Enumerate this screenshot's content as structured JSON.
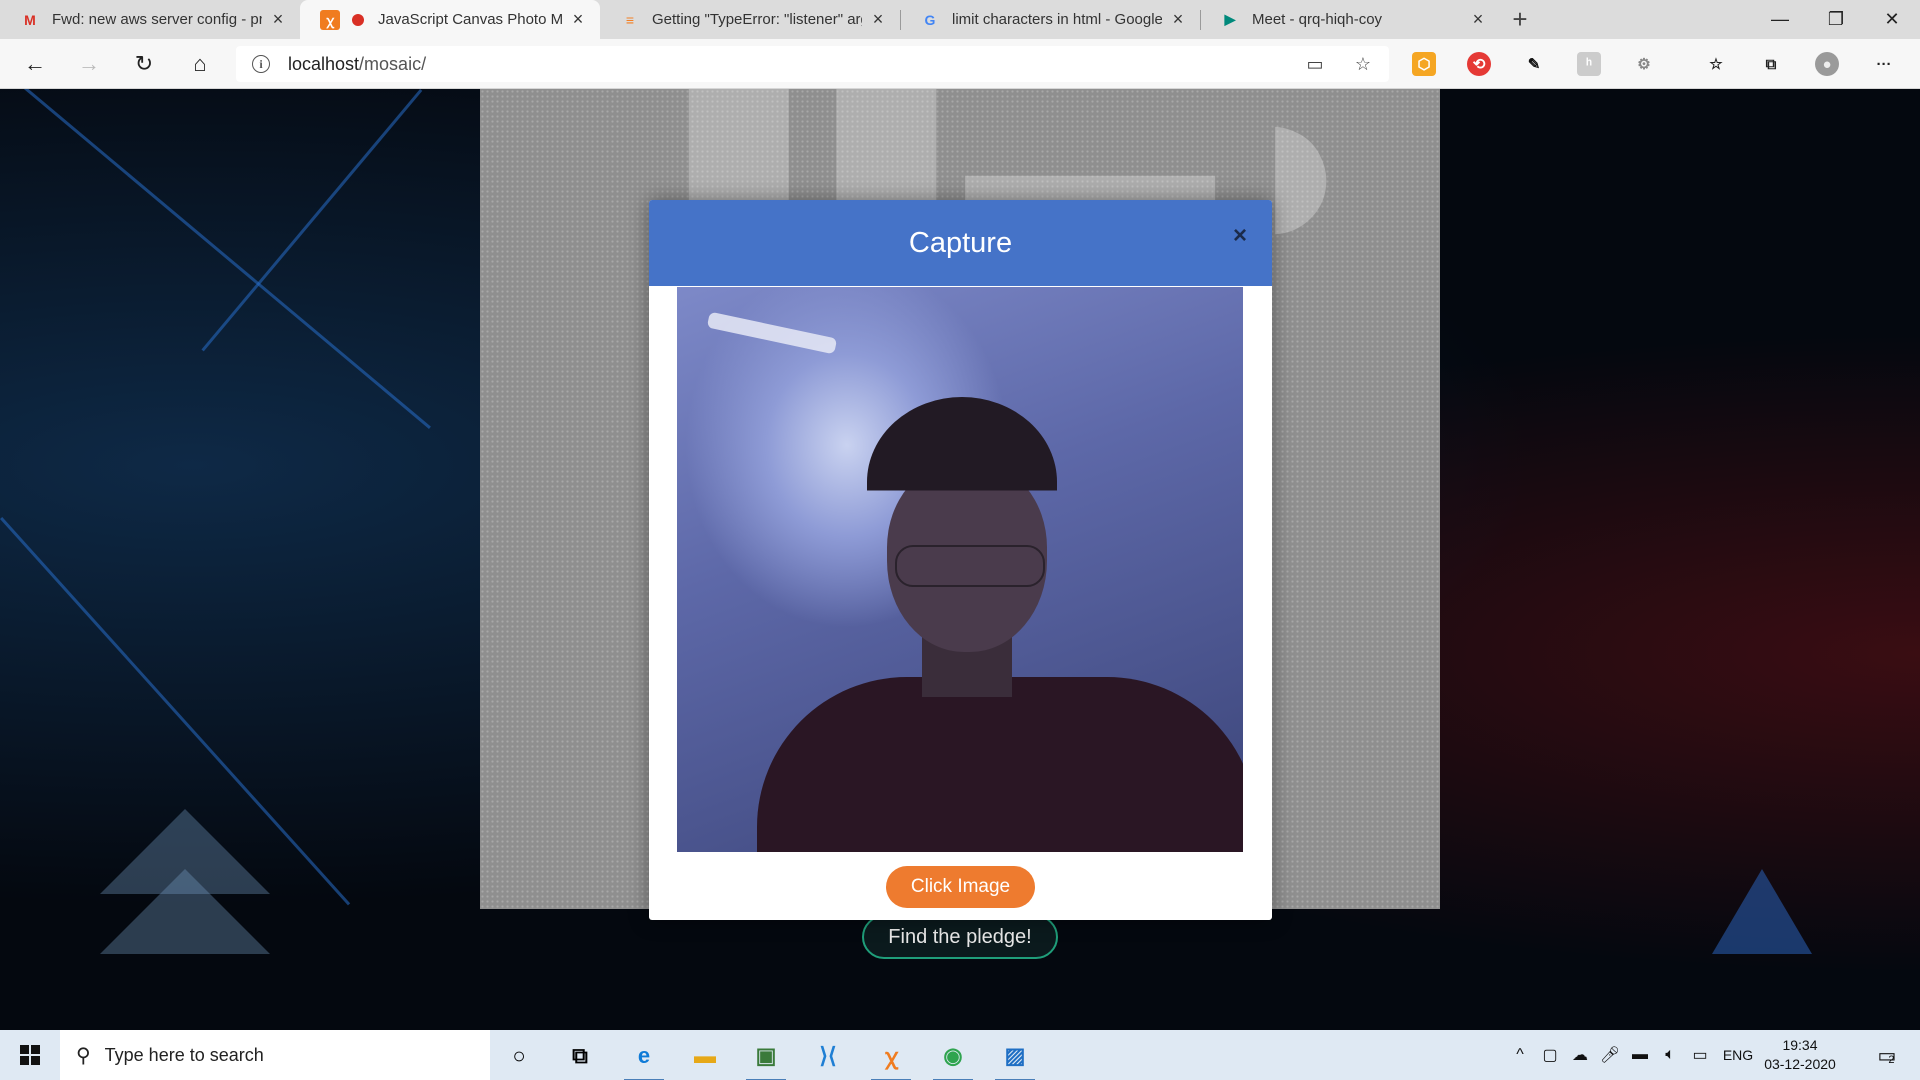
{
  "browser": {
    "tabs": [
      {
        "title": "Fwd: new aws server config - pra",
        "favicon": "gmail-icon",
        "active": false
      },
      {
        "title": "JavaScript Canvas Photo Mo",
        "favicon": "xampp-icon",
        "active": true,
        "recording": true
      },
      {
        "title": "Getting \"TypeError: \"listener\" arg",
        "favicon": "stackoverflow-icon",
        "active": false
      },
      {
        "title": "limit characters in html - Google",
        "favicon": "google-icon",
        "active": false
      },
      {
        "title": "Meet - qrq-hiqh-coy",
        "favicon": "meet-icon",
        "active": false
      }
    ],
    "url_host": "localhost",
    "url_path": "/mosaic/"
  },
  "page": {
    "find_button": "Find the pledge!"
  },
  "modal": {
    "title": "Capture",
    "close_symbol": "×",
    "capture_button": "Click Image"
  },
  "taskbar": {
    "search_placeholder": "Type here to search",
    "language": "ENG",
    "time": "19:34",
    "date": "03-12-2020",
    "notifications_count": "2"
  },
  "colors": {
    "modal_header": "#4573c8",
    "capture_button": "#ee7b2f",
    "find_button_border": "#1f9e7a"
  }
}
